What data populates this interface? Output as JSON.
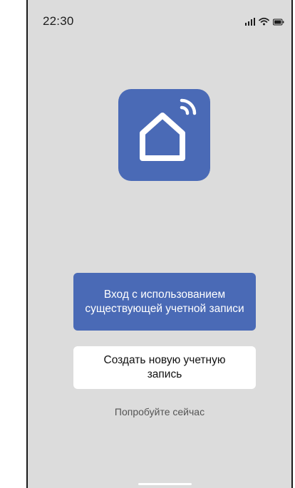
{
  "status_bar": {
    "time": "22:30",
    "icons": [
      "signal-icon",
      "wifi-icon",
      "battery-icon"
    ]
  },
  "logo": {
    "icon": "smart-home-icon",
    "background_color": "#4a6ab6"
  },
  "buttons": {
    "login_label": "Вход с использованием существующей учетной записи",
    "register_label": "Создать новую учетную запись"
  },
  "try_now_label": "Попробуйте сейчас",
  "colors": {
    "accent": "#4a6ab6",
    "background": "#dcdcdc"
  }
}
